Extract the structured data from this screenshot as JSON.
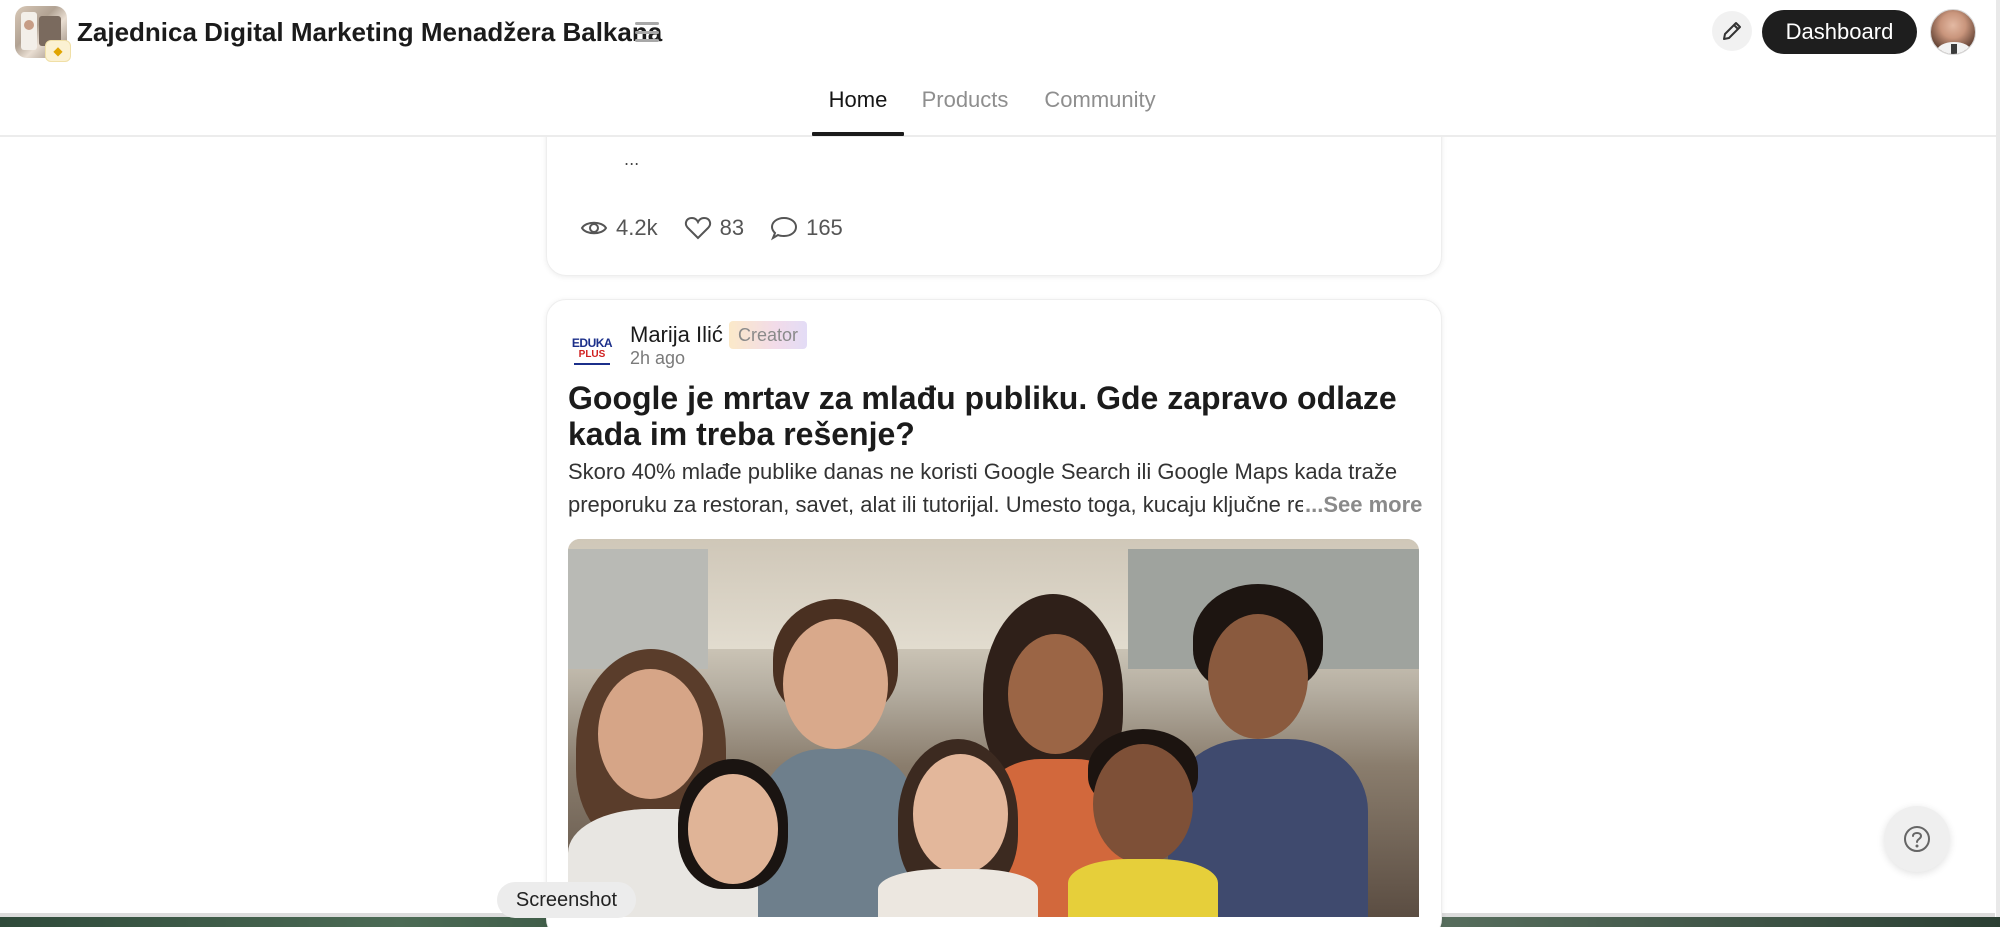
{
  "header": {
    "community_title": "Zajednica Digital Marketing Menadžera Balkana",
    "dashboard_label": "Dashboard"
  },
  "nav": {
    "tabs": [
      {
        "label": "Home",
        "active": true
      },
      {
        "label": "Products",
        "active": false
      },
      {
        "label": "Community",
        "active": false
      }
    ]
  },
  "previous_post": {
    "truncation": "...",
    "views": "4.2k",
    "likes": "83",
    "comments": "165"
  },
  "post": {
    "author_logo_line1": "EDUKA",
    "author_logo_line2": "PLUS",
    "author_name": "Marija Ilić",
    "badge": "Creator",
    "time": "2h ago",
    "title": "Google je mrtav za mlađu publiku. Gde zapravo odlaze kada im treba rešenje?",
    "body_line1": "Skoro 40% mlađe publike danas ne koristi Google Search ili Google Maps kada traže",
    "body_line2": "preporuku za restoran, savet, alat ili tutorijal. Umesto toga, kucaju ključne re",
    "see_more": "...See more"
  },
  "overlay": {
    "screenshot_label": "Screenshot"
  },
  "icons": {
    "menu": "hamburger-icon",
    "edit": "pencil-icon",
    "views": "eye-icon",
    "likes": "heart-icon",
    "comments": "comment-icon",
    "help": "question-circle-icon",
    "badge": "diamond-icon"
  },
  "colors": {
    "accent_dark": "#1e1e1e",
    "tab_inactive": "#8e8e8e",
    "badge_gradient_start": "#fbe9c9",
    "badge_gradient_end": "#e3dcf6"
  }
}
